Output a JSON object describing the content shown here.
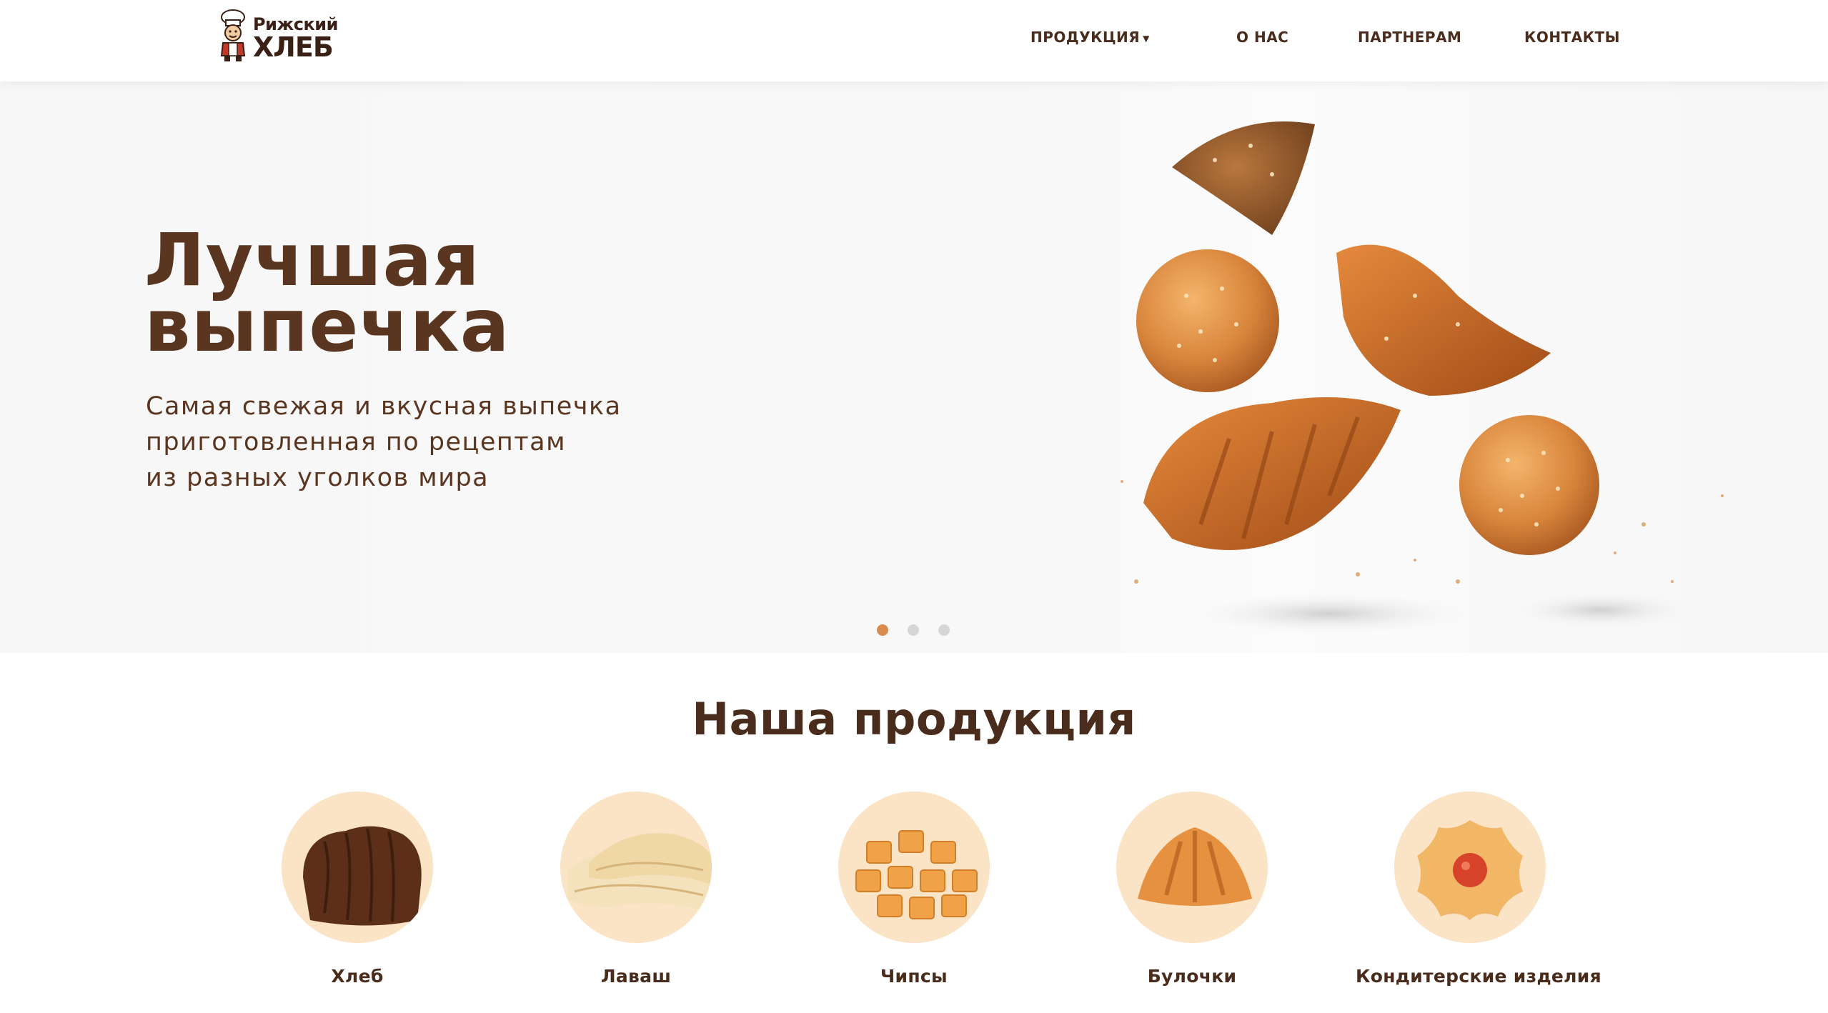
{
  "header": {
    "logo_top": "Рижский",
    "logo_bottom": "ХЛЕБ",
    "nav": {
      "products": "ПРОДУКЦИЯ",
      "about": "О НАС",
      "partners": "ПАРТНЕРАМ",
      "contacts": "КОНТАКТЫ"
    }
  },
  "hero": {
    "title_line1": "Лучшая",
    "title_line2": "выпечка",
    "subtitle_line1": "Самая свежая и вкусная выпечка",
    "subtitle_line2": "приготовленная по рецептам",
    "subtitle_line3": "из разных уголков мира",
    "slides_total": 3,
    "active_slide": 1
  },
  "products": {
    "title": "Наша продукция",
    "items": [
      {
        "label": "Хлеб",
        "icon": "bread-loaf-icon"
      },
      {
        "label": "Лаваш",
        "icon": "lavash-icon"
      },
      {
        "label": "Чипсы",
        "icon": "croutons-icon"
      },
      {
        "label": "Булочки",
        "icon": "croissant-icon"
      },
      {
        "label": "Кондитерские изделия",
        "icon": "cookie-icon"
      }
    ]
  },
  "colors": {
    "brand_brown": "#5a3520",
    "accent_orange": "#d98a4d",
    "circle_bg": "#fbe3c6",
    "dot_inactive": "#d6d6d6"
  }
}
